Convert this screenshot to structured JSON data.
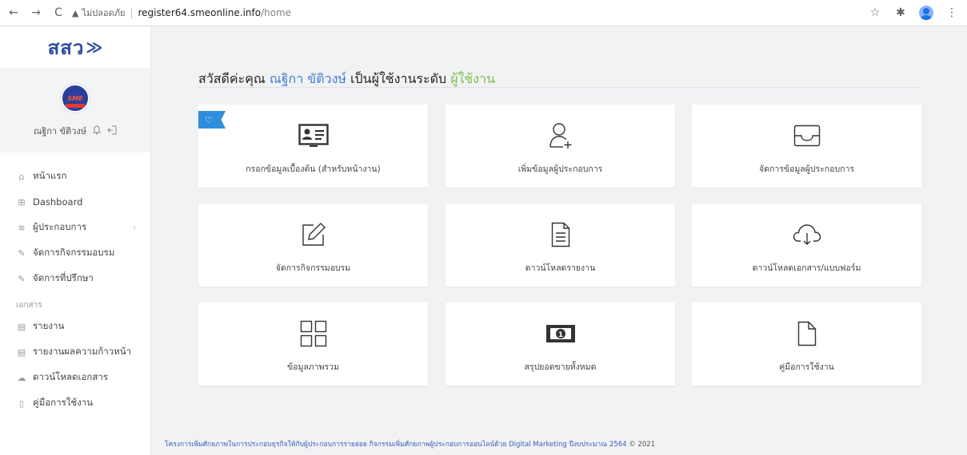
{
  "browser": {
    "back": "←",
    "forward": "→",
    "reload": "C",
    "security_icon": "warning-triangle",
    "security_text": "ไม่ปลอดภัย",
    "url_host": "register64.smeonline.info",
    "url_path": "/home"
  },
  "sidebar": {
    "logo_text": "สสว",
    "logo_mark": "≫",
    "user_name": "ณฐิกา ขัติวงษ์",
    "menu": [
      {
        "label": "หน้าแรก",
        "icon": "home-icon"
      },
      {
        "label": "Dashboard",
        "icon": "grid-icon"
      },
      {
        "label": "ผู้ประกอบการ",
        "icon": "layers-icon"
      },
      {
        "label": "จัดการกิจกรรมอบรม",
        "icon": "edit-icon"
      },
      {
        "label": "จัดการที่ปรึกษา",
        "icon": "edit-icon"
      }
    ],
    "section_label": "เอกสาร",
    "docs": [
      {
        "label": "รายงาน",
        "icon": "document-icon"
      },
      {
        "label": "รายงานผลความก้าวหน้า",
        "icon": "document-icon"
      },
      {
        "label": "ดาวน์โหลดเอกสาร",
        "icon": "cloud-download-icon"
      },
      {
        "label": "คู่มือการใช้งาน",
        "icon": "file-icon"
      }
    ]
  },
  "main": {
    "greeting_prefix": "สวัสดีค่ะคุณ",
    "greeting_name": "ณฐิกา ขัติวงษ์",
    "greeting_middle": "เป็นผู้ใช้งานระดับ",
    "greeting_level": "ผู้ใช้งาน",
    "cards": [
      {
        "label": "กรอกข้อมูลเบื้องต้น (สำหรับหน้างาน)",
        "icon": "id-card-icon"
      },
      {
        "label": "เพิ่มข้อมูลผู้ประกอบการ",
        "icon": "add-user-icon"
      },
      {
        "label": "จัดการข้อมูลผู้ประกอบการ",
        "icon": "inbox-icon"
      },
      {
        "label": "จัดการกิจกรรมอบรม",
        "icon": "edit-icon"
      },
      {
        "label": "ดาวน์โหลดรายงาน",
        "icon": "document-icon"
      },
      {
        "label": "ดาวน์โหลดเอกสาร/แบบฟอร์ม",
        "icon": "cloud-download-icon"
      },
      {
        "label": "ข้อมูลภาพรวม",
        "icon": "grid-icon"
      },
      {
        "label": "สรุปยอดขายทั้งหมด",
        "icon": "money-icon"
      },
      {
        "label": "คู่มือการใช้งาน",
        "icon": "file-icon"
      }
    ]
  },
  "footer": {
    "text": "โครงการเพิ่มศักยภาพในการประกอบธุรกิจให้กับผู้ประกอบการรายย่อย กิจกรรมเพิ่มศักยภาพผู้ประกอบการออนไลน์ด้วย Digital Marketing ปีงบประมาณ 2564",
    "copyright": "© 2021"
  },
  "colors": {
    "accent_blue": "#3f7ed6",
    "level_green": "#7cbf4a",
    "ribbon_blue": "#2f8edc",
    "logo_blue": "#2d4da3"
  }
}
